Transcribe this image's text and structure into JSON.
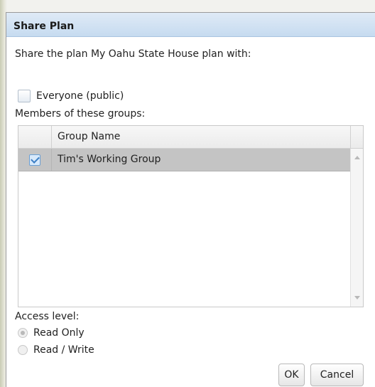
{
  "dialog": {
    "title": "Share Plan"
  },
  "intro_text": "Share the plan My Oahu State House plan with:",
  "everyone": {
    "label": "Everyone (public)",
    "checked": false
  },
  "members_label": "Members of these groups:",
  "groups_table": {
    "columns": [
      "Group Name"
    ],
    "rows": [
      {
        "name": "Tim's Working Group",
        "checked": true
      }
    ]
  },
  "access": {
    "label": "Access level:",
    "options": [
      "Read Only",
      "Read / Write"
    ],
    "selected": "Read Only"
  },
  "buttons": {
    "ok": "OK",
    "cancel": "Cancel"
  }
}
